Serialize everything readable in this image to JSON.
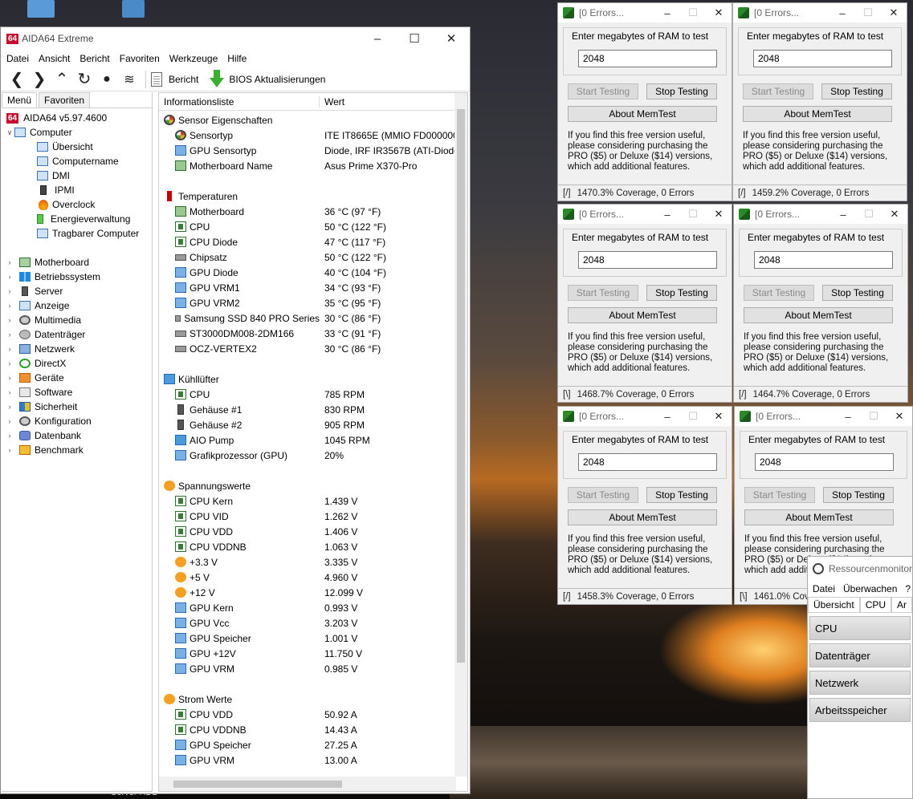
{
  "desktop": {
    "bottom_label": "Server HDD"
  },
  "aida": {
    "title": "AIDA64 Extreme",
    "logo": "64",
    "menu": [
      "Datei",
      "Ansicht",
      "Bericht",
      "Favoriten",
      "Werkzeuge",
      "Hilfe"
    ],
    "toolbar": {
      "report": "Bericht",
      "bios": "BIOS Aktualisierungen"
    },
    "tabs": [
      "Menü",
      "Favoriten"
    ],
    "tree": {
      "root": "AIDA64 v5.97.4600",
      "computer": "Computer",
      "computer_children": [
        "Übersicht",
        "Computername",
        "DMI",
        "IPMI",
        "Overclock",
        "Energieverwaltung",
        "Tragbarer Computer"
      ],
      "groups": [
        "Motherboard",
        "Betriebssystem",
        "Server",
        "Anzeige",
        "Multimedia",
        "Datenträger",
        "Netzwerk",
        "DirectX",
        "Geräte",
        "Software",
        "Sicherheit",
        "Konfiguration",
        "Datenbank",
        "Benchmark"
      ]
    },
    "columns": {
      "info": "Informationsliste",
      "value": "Wert"
    },
    "sensor_props": {
      "heading": "Sensor Eigenschaften",
      "rows": [
        {
          "name": "Sensortyp",
          "value": "ITE IT8665E  (MMIO FD000000h"
        },
        {
          "name": "GPU Sensortyp",
          "value": "Diode, IRF IR3567B  (ATI-Diode,"
        },
        {
          "name": "Motherboard Name",
          "value": "Asus Prime X370-Pro"
        }
      ]
    },
    "temperatures": {
      "heading": "Temperaturen",
      "rows": [
        {
          "name": "Motherboard",
          "value": "36 °C  (97 °F)"
        },
        {
          "name": "CPU",
          "value": "50 °C  (122 °F)"
        },
        {
          "name": "CPU Diode",
          "value": "47 °C  (117 °F)"
        },
        {
          "name": "Chipsatz",
          "value": "50 °C  (122 °F)"
        },
        {
          "name": "GPU Diode",
          "value": "40 °C  (104 °F)"
        },
        {
          "name": "GPU VRM1",
          "value": "34 °C  (93 °F)"
        },
        {
          "name": "GPU VRM2",
          "value": "35 °C  (95 °F)"
        },
        {
          "name": "Samsung SSD 840 PRO Series",
          "value": "30 °C  (86 °F)"
        },
        {
          "name": "ST3000DM008-2DM166",
          "value": "33 °C  (91 °F)"
        },
        {
          "name": "OCZ-VERTEX2",
          "value": "30 °C  (86 °F)"
        }
      ]
    },
    "fans": {
      "heading": "Kühllüfter",
      "rows": [
        {
          "name": "CPU",
          "value": "785 RPM"
        },
        {
          "name": "Gehäuse #1",
          "value": "830 RPM"
        },
        {
          "name": "Gehäuse #2",
          "value": "905 RPM"
        },
        {
          "name": "AIO Pump",
          "value": "1045 RPM"
        },
        {
          "name": "Grafikprozessor (GPU)",
          "value": "20%"
        }
      ]
    },
    "voltages": {
      "heading": "Spannungswerte",
      "rows": [
        {
          "name": "CPU Kern",
          "value": "1.439 V"
        },
        {
          "name": "CPU VID",
          "value": "1.262 V"
        },
        {
          "name": "CPU VDD",
          "value": "1.406 V"
        },
        {
          "name": "CPU VDDNB",
          "value": "1.063 V"
        },
        {
          "name": "+3.3 V",
          "value": "3.335 V"
        },
        {
          "name": "+5 V",
          "value": "4.960 V"
        },
        {
          "name": "+12 V",
          "value": "12.099 V"
        },
        {
          "name": "GPU Kern",
          "value": "0.993 V"
        },
        {
          "name": "GPU Vcc",
          "value": "3.203 V"
        },
        {
          "name": "GPU Speicher",
          "value": "1.001 V"
        },
        {
          "name": "GPU +12V",
          "value": "11.750 V"
        },
        {
          "name": "GPU VRM",
          "value": "0.985 V"
        }
      ]
    },
    "currents": {
      "heading": "Strom Werte",
      "rows": [
        {
          "name": "CPU VDD",
          "value": "50.92 A"
        },
        {
          "name": "CPU VDDNB",
          "value": "14.43 A"
        },
        {
          "name": "GPU Speicher",
          "value": "27.25 A"
        },
        {
          "name": "GPU VRM",
          "value": "13.00 A"
        }
      ]
    }
  },
  "memtest": {
    "title": "[0 Errors...",
    "prompt": "Enter megabytes of RAM to test",
    "value": "2048",
    "start": "Start Testing",
    "stop": "Stop Testing",
    "about": "About MemTest",
    "promo": "If you find this free version useful, please considering purchasing the PRO ($5) or Deluxe ($14) versions, which add additional features.",
    "instances": [
      {
        "spinner": "[/]",
        "status": "1470.3% Coverage, 0 Errors"
      },
      {
        "spinner": "[/]",
        "status": "1459.2% Coverage, 0 Errors"
      },
      {
        "spinner": "[\\]",
        "status": "1468.7% Coverage, 0 Errors"
      },
      {
        "spinner": "[/]",
        "status": "1464.7% Coverage, 0 Errors"
      },
      {
        "spinner": "[/]",
        "status": "1458.3% Coverage, 0 Errors"
      },
      {
        "spinner": "[\\]",
        "status": "1461.0% Cove"
      }
    ]
  },
  "resmon": {
    "title": "Ressourcenmonitor",
    "menu": [
      "Datei",
      "Überwachen",
      "?"
    ],
    "tabs": [
      "Übersicht",
      "CPU",
      "Ar"
    ],
    "sections": [
      "CPU",
      "Datenträger",
      "Netzwerk",
      "Arbeitsspeicher"
    ]
  }
}
